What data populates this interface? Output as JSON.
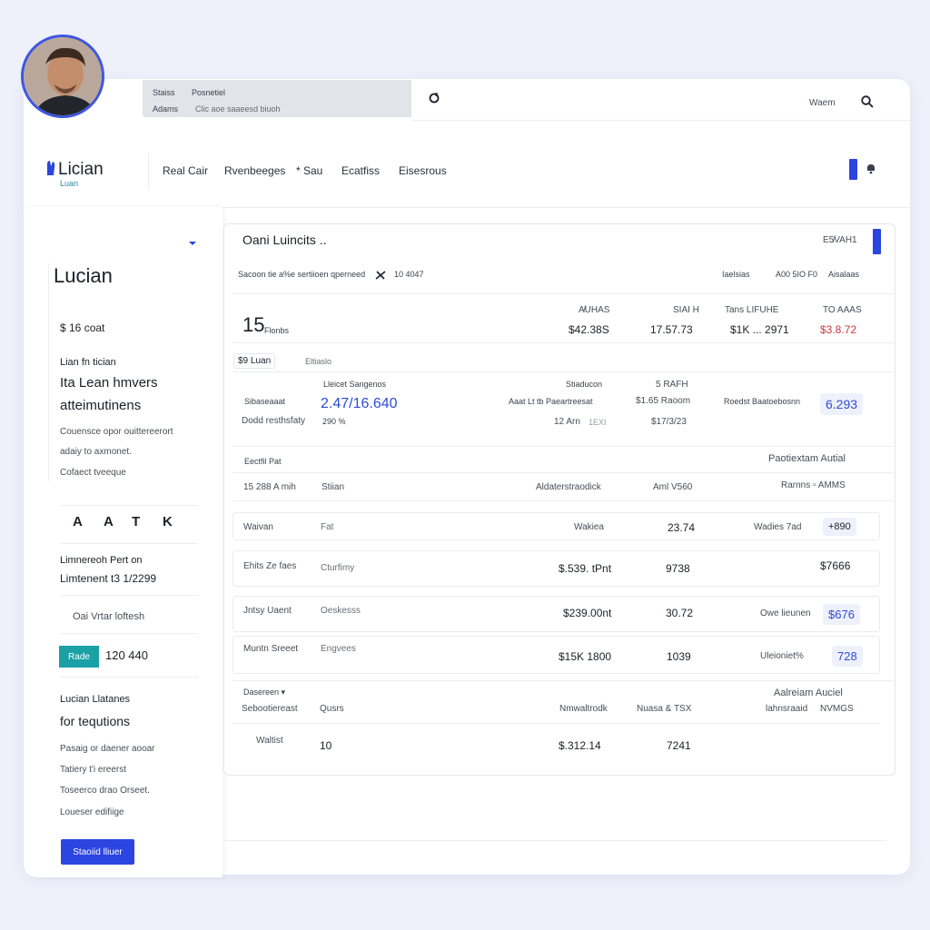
{
  "browser": {
    "row1_left": "Staiss",
    "row1_right": "Posnetiel",
    "row2_left": "Adams",
    "row2_right": "Clic aoe saaeesd biuoh"
  },
  "topbar": {
    "user_label": "Waem"
  },
  "brand": {
    "name": "Lician",
    "sub": "Luan"
  },
  "nav": {
    "items": [
      "Real Cair",
      "Rvenbeeges",
      "* Sau",
      "Ecatfiss",
      "Eisesrous"
    ]
  },
  "sidebar": {
    "heading": "Lucian",
    "price": "$ 1⁢6 coat",
    "label_small": "Lian fn tician",
    "title_line1": "Ita Lean hmvers",
    "title_line2": "atteimutinens",
    "desc1": "Couensce opor ouittereerort",
    "desc2": "adaiy to axmonet.",
    "desc3": "Cofaect tveeque",
    "icons": [
      "A",
      "A",
      "T",
      "K"
    ],
    "sub_label": "Limnereoh Pert on",
    "sub_value": "Limtenent t3 1/2299",
    "link": "Oai Vrtar loftesh",
    "teal_btn": "Rade",
    "teal_value": "120 440",
    "sec_label": "Lucian Llatanes",
    "sec_title": "for tequtions",
    "item1": "Pasaig or daener aooar",
    "item2": "Tatiery t'i ereerst",
    "item3": "Toseerco drao Orseet.",
    "item4": "Loueser edifiige",
    "button": "Staoiid lliuer"
  },
  "panel": {
    "title": "Oani Luincits  ..",
    "title_right": "E5̸VAH1",
    "sub_left": "Sacoon tie a%e sertiioen qperneed",
    "sub_mid": "10 4047",
    "sub_right1": "Iaelsias",
    "sub_right2": "A00 5IO  F0",
    "sub_right3": "Aisalaas",
    "summary": {
      "big": "15",
      "big_sub": "Flonbs",
      "headers": [
        "A̸UHAS",
        "SIAI H",
        "Tans   LIFUHE",
        "TO AAAS"
      ],
      "values": [
        "$42.38S",
        "17.57.73",
        "$1K  ... 2971",
        "$3.8.72"
      ]
    },
    "filter_label": "$9 Luan",
    "filter_tab": "Eltiaslo",
    "stats": {
      "label1": "Sibaseaaat",
      "label2": "Dodd resthsfaty",
      "col1_head": "Lleicet Sangenos",
      "col1_val": "2.47/16.640",
      "col1_sub": "290 %",
      "mid_label": "Aaat    Lt tb Paeartreesat",
      "mid_head": "Stiaducon",
      "mid_sub": "12 Arn",
      "mid_sub2": "1EXI",
      "r_head": "5 RAFH",
      "r_val": "$1.65 Raoom",
      "r_val2": "$17/3/23",
      "right_label": "Roedst Baatoebosnn",
      "right_val": "6.293"
    },
    "table_head": {
      "left": "Eectfil Pat",
      "right": "Paotiextam Autial"
    },
    "row_header": {
      "c1": "15 288 A mih",
      "c2": "Stiian",
      "c3": "Aldaterstraodick",
      "c4": "Aml V560",
      "c5": "Rarnns  ▫ AMMS"
    },
    "rows": [
      {
        "name": "Waivan",
        "cat": "Fat",
        "amount": "Wakiea",
        "qty": "23.74",
        "note": "Wadies 7ad",
        "badge": "+890"
      },
      {
        "name": "Ehits Ze faes",
        "cat": "Cturfimy",
        "amount": "$.539. tPnt",
        "qty": "9738",
        "note": "",
        "badge": "$7666"
      },
      {
        "name": "Jntsy Uaent",
        "cat": "Oeskesss",
        "amount": "$239.00nt",
        "qty": "30.72",
        "note": "Owe lieunen",
        "badge": "$676"
      },
      {
        "name": "Muntn Sreeet",
        "cat": "Engvees",
        "amount": "$15K 1800",
        "qty": "1039",
        "note": "Uleioniet%",
        "badge": "728"
      }
    ],
    "footer_head": {
      "left": "Dasereen ▾",
      "right": "Aalreiam Auciel",
      "c1": "Sebootiereast",
      "c2": "Qusrs",
      "c3": "Nmwaltrodk",
      "c4": "Nuasa & TSX",
      "c5": "lahnsraaid",
      "c6": "NVMGS"
    },
    "footer_row": {
      "name": "Waltist",
      "cat": "10",
      "amount": "$.312.1⁢4",
      "qty": "7241"
    }
  },
  "colors": {
    "accent": "#2b45e0",
    "teal": "#1aa1a6",
    "red": "#d0363f",
    "background": "#eef0fa"
  }
}
